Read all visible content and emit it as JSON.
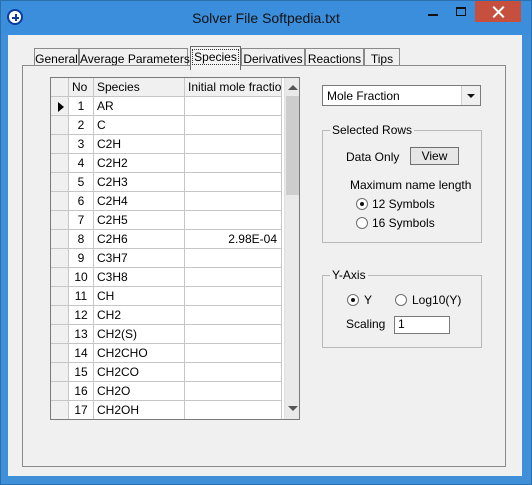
{
  "window": {
    "title": "Solver File  Softpedia.txt"
  },
  "tabs": [
    {
      "label": "General"
    },
    {
      "label": "Average Parameters"
    },
    {
      "label": "Species"
    },
    {
      "label": "Derivatives"
    },
    {
      "label": "Reactions"
    },
    {
      "label": "Tips"
    }
  ],
  "grid": {
    "headers": {
      "no": "No",
      "species": "Species",
      "fraction": "Initial mole fraction"
    },
    "rows": [
      {
        "no": "1",
        "species": "AR",
        "fraction": ""
      },
      {
        "no": "2",
        "species": "C",
        "fraction": ""
      },
      {
        "no": "3",
        "species": "C2H",
        "fraction": ""
      },
      {
        "no": "4",
        "species": "C2H2",
        "fraction": ""
      },
      {
        "no": "5",
        "species": "C2H3",
        "fraction": ""
      },
      {
        "no": "6",
        "species": "C2H4",
        "fraction": ""
      },
      {
        "no": "7",
        "species": "C2H5",
        "fraction": ""
      },
      {
        "no": "8",
        "species": "C2H6",
        "fraction": "2.98E-04"
      },
      {
        "no": "9",
        "species": "C3H7",
        "fraction": ""
      },
      {
        "no": "10",
        "species": "C3H8",
        "fraction": ""
      },
      {
        "no": "11",
        "species": "CH",
        "fraction": ""
      },
      {
        "no": "12",
        "species": "CH2",
        "fraction": ""
      },
      {
        "no": "13",
        "species": "CH2(S)",
        "fraction": ""
      },
      {
        "no": "14",
        "species": "CH2CHO",
        "fraction": ""
      },
      {
        "no": "15",
        "species": "CH2CO",
        "fraction": ""
      },
      {
        "no": "16",
        "species": "CH2O",
        "fraction": ""
      },
      {
        "no": "17",
        "species": "CH2OH",
        "fraction": ""
      }
    ]
  },
  "mode_select": {
    "value": "Mole Fraction"
  },
  "selected_rows": {
    "legend": "Selected Rows",
    "data_only_label": "Data Only",
    "view_button": "View",
    "max_name_label": "Maximum name length",
    "option_12": "12 Symbols",
    "option_16": "16 Symbols",
    "selected": "12 Symbols"
  },
  "y_axis": {
    "legend": "Y-Axis",
    "option_y": "Y",
    "option_log": "Log10(Y)",
    "selected": "Y",
    "scaling_label": "Scaling",
    "scaling_value": "1"
  }
}
